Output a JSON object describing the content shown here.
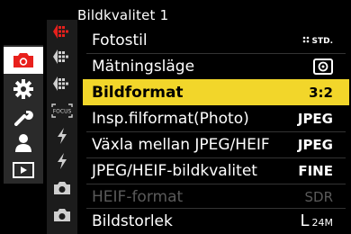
{
  "header": {
    "title": "Bildkvalitet 1"
  },
  "categories": [
    {
      "icon": "camera-icon",
      "active": true
    },
    {
      "icon": "gear-icon",
      "active": false
    },
    {
      "icon": "wrench-icon",
      "active": false
    },
    {
      "icon": "person-icon",
      "active": false
    },
    {
      "icon": "playback-icon",
      "active": false
    }
  ],
  "subtabs": [
    {
      "icon": "quality-page-1-icon",
      "active": true
    },
    {
      "icon": "quality-page-2-icon",
      "active": false
    },
    {
      "icon": "quality-page-3-icon",
      "active": false
    },
    {
      "icon": "focus-icon",
      "label": "FOCUS",
      "active": false
    },
    {
      "icon": "flash-icon",
      "active": false
    },
    {
      "icon": "flash-2-icon",
      "active": false
    },
    {
      "icon": "camera-custom-1-icon",
      "active": false
    },
    {
      "icon": "camera-custom-2-icon",
      "active": false
    }
  ],
  "menu": {
    "items": [
      {
        "label": "Fotostil",
        "value": "STD.",
        "value_icon": "photo-style-icon"
      },
      {
        "label": "Mätningsläge",
        "value": "",
        "value_icon": "metering-icon"
      },
      {
        "label": "Bildformat",
        "value": "3:2",
        "selected": true
      },
      {
        "label": "Insp.filformat(Photo)",
        "value": "JPEG"
      },
      {
        "label": "Växla mellan JPEG/HEIF",
        "value": "JPEG"
      },
      {
        "label": "JPEG/HEIF-bildkvalitet",
        "value": "FINE"
      },
      {
        "label": "HEIF-format",
        "value": "SDR",
        "disabled": true
      },
      {
        "label": "Bildstorlek",
        "value": "24M",
        "value_prefix": "L"
      }
    ]
  },
  "colors": {
    "accent_red": "#e8201c",
    "selection_yellow": "#f2d62a"
  }
}
